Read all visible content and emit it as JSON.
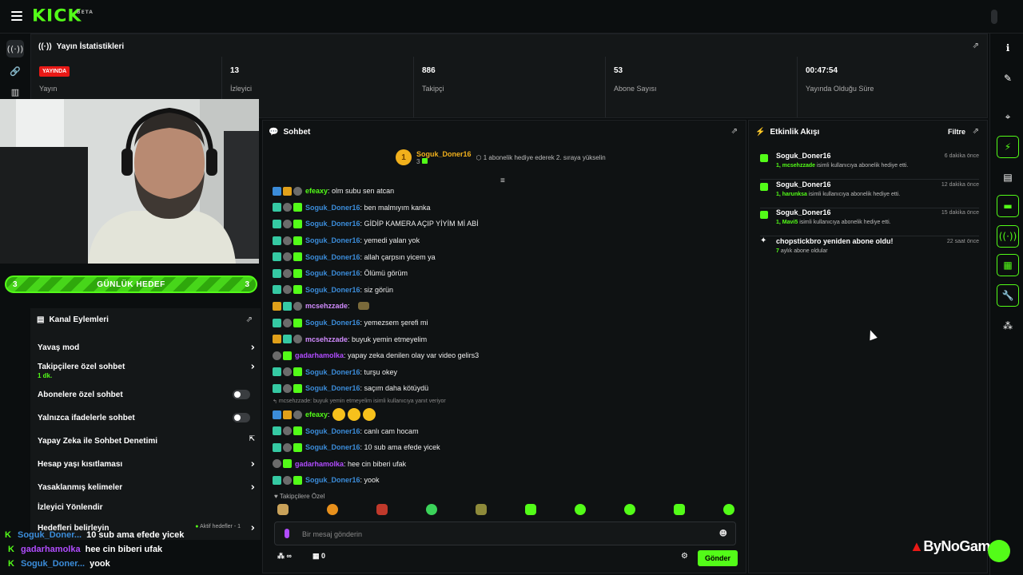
{
  "app": {
    "logo": "KICK",
    "logo_tag": "BETA"
  },
  "stats": {
    "title": "Yayın İstatistikleri",
    "live_badge": "YAYINDA",
    "items": [
      {
        "value": "",
        "label": "Yayın"
      },
      {
        "value": "13",
        "label": "İzleyici"
      },
      {
        "value": "886",
        "label": "Takipçi"
      },
      {
        "value": "53",
        "label": "Abone Sayısı"
      },
      {
        "value": "00:47:54",
        "label": "Yayında Olduğu Süre"
      }
    ]
  },
  "goal": {
    "left": "3",
    "title": "GÜNLÜK HEDEF",
    "right": "3"
  },
  "actions": {
    "title": "Kanal Eylemleri",
    "items": [
      {
        "label": "Yavaş mod",
        "sub": ""
      },
      {
        "label": "Takipçilere özel sohbet",
        "sub": "1 dk."
      },
      {
        "label": "Abonelere özel sohbet",
        "sub": ""
      },
      {
        "label": "Yalnızca ifadelerle sohbet",
        "sub": ""
      },
      {
        "label": "Yapay Zeka ile Sohbet Denetimi",
        "sub": ""
      },
      {
        "label": "Hesap yaşı kısıtlaması",
        "sub": ""
      },
      {
        "label": "Yasaklanmış kelimeler",
        "sub": ""
      },
      {
        "label": "İzleyici Yönlendir",
        "sub": ""
      },
      {
        "label": "Hedefleri belirleyin",
        "sub": "",
        "extra": "Aktif hedefler - 1"
      }
    ]
  },
  "overlay": [
    {
      "user": "Soguk_Doner...",
      "text": "10 sub ama efede yicek",
      "color": "#3b8cd9"
    },
    {
      "user": "gadarhamolka",
      "text": "hee cin biberi ufak",
      "color": "#b14cff"
    },
    {
      "user": "Soguk_Doner...",
      "text": "yook",
      "color": "#3b8cd9"
    }
  ],
  "chat": {
    "title": "Sohbet",
    "pinned": {
      "rank": "1",
      "name": "Soguk_Doner16",
      "count": "3",
      "message": "1 abonelik hediye ederek 2. sıraya yükselin"
    },
    "messages": [
      {
        "user": "efeaxy",
        "text": ": olm subu sen atcan",
        "color": "#53fc18"
      },
      {
        "user": "Soguk_Doner16",
        "text": ": ben malmıyım kanka",
        "color": "#3b8cd9"
      },
      {
        "user": "Soguk_Doner16",
        "text": ": GİDİP KAMERA AÇIP YİYİM Mİ ABİ",
        "color": "#3b8cd9"
      },
      {
        "user": "Soguk_Doner16",
        "text": ": yemedi yalan yok",
        "color": "#3b8cd9"
      },
      {
        "user": "Soguk_Doner16",
        "text": ": allah çarpsın yicem ya",
        "color": "#3b8cd9"
      },
      {
        "user": "Soguk_Doner16",
        "text": ": Ölümü görüm",
        "color": "#3b8cd9"
      },
      {
        "user": "Soguk_Doner16",
        "text": ": siz görün",
        "color": "#3b8cd9"
      },
      {
        "user": "mcsehzzade",
        "text": ":",
        "color": "#d28cff"
      },
      {
        "user": "Soguk_Doner16",
        "text": ": yemezsem şerefi mi",
        "color": "#3b8cd9"
      },
      {
        "user": "mcsehzzade",
        "text": ": buyuk yemin etmeyelim",
        "color": "#d28cff"
      },
      {
        "user": "gadarhamolka",
        "text": ": yapay zeka denilen olay var video gelirs3",
        "color": "#b14cff"
      },
      {
        "user": "Soguk_Doner16",
        "text": ": turşu okey",
        "color": "#3b8cd9"
      },
      {
        "user": "Soguk_Doner16",
        "text": ": saçım daha kötüydü",
        "color": "#3b8cd9"
      }
    ],
    "reply_note": "mcsehzzade: buyuk yemin etmeyelim isimli kullanıcıya yanıt veriyor",
    "messages2": [
      {
        "user": "efeaxy",
        "text": ":",
        "color": "#53fc18"
      },
      {
        "user": "Soguk_Doner16",
        "text": ": canlı cam hocam",
        "color": "#3b8cd9"
      },
      {
        "user": "Soguk_Doner16",
        "text": ": 10 sub ama efede yicek",
        "color": "#3b8cd9"
      },
      {
        "user": "gadarhamolka",
        "text": ": hee cin biberi ufak",
        "color": "#b14cff"
      },
      {
        "user": "Soguk_Doner16",
        "text": ": yook",
        "color": "#3b8cd9"
      }
    ],
    "followers_label": "Takipçilere Özel",
    "input_placeholder": "Bir mesaj gönderin",
    "infinity": "∞",
    "count": "0",
    "send": "Gönder"
  },
  "feed": {
    "title": "Etkinlik Akışı",
    "filter": "Filtre",
    "events": [
      {
        "name": "Soguk_Doner16",
        "time": "6 dakika önce",
        "desc_strong": "1, mcsehzzade",
        "desc": " isimli kullanıcıya abonelik hediye etti."
      },
      {
        "name": "Soguk_Doner16",
        "time": "12 dakika önce",
        "desc_strong": "1, harunksa",
        "desc": " isimli kullanıcıya abonelik hediye etti."
      },
      {
        "name": "Soguk_Doner16",
        "time": "15 dakika önce",
        "desc_strong": "1, Mavi5",
        "desc": " isimli kullanıcıya abonelik hediye etti."
      },
      {
        "name": "chopstickbro yeniden abone oldu!",
        "time": "22 saat önce",
        "desc_strong": "7",
        "desc": " aylık abone oldular"
      }
    ]
  },
  "watermark": "ByNoGame",
  "colors": {
    "accent": "#53fc18",
    "live": "#e91916",
    "gold": "#f1b01c"
  }
}
